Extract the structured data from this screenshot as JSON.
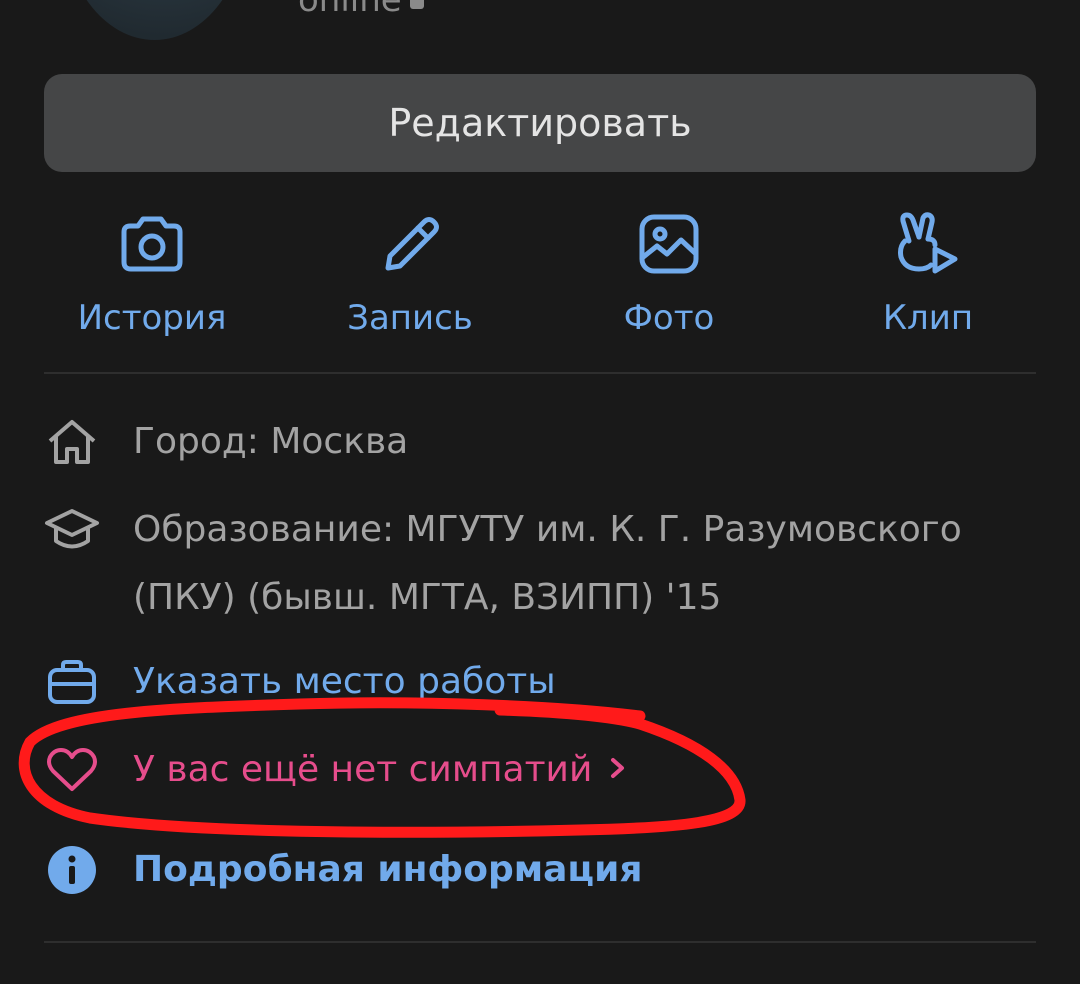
{
  "header": {
    "status": "online"
  },
  "edit_button": {
    "label": "Редактировать"
  },
  "actions": [
    {
      "label": "История",
      "icon": "camera-icon"
    },
    {
      "label": "Запись",
      "icon": "pencil-icon"
    },
    {
      "label": "Фото",
      "icon": "photo-icon"
    },
    {
      "label": "Клип",
      "icon": "clip-icon"
    }
  ],
  "info": {
    "city": {
      "text": "Город: Москва",
      "icon": "home-icon"
    },
    "education": {
      "line1": "Образование: МГУТУ им. К. Г. Разумовского",
      "line2": "(ПКУ) (бывш. МГТА, ВЗИПП) '15",
      "icon": "graduation-cap-icon"
    },
    "work": {
      "text": "Указать место работы",
      "icon": "briefcase-icon"
    },
    "likes": {
      "text": "У вас ещё нет симпатий",
      "icon": "heart-icon"
    },
    "details": {
      "text": "Подробная информация",
      "icon": "info-icon"
    }
  },
  "colors": {
    "background": "#191919",
    "accent_blue": "#71aaeb",
    "pink": "#e64d8c",
    "annotation_red": "#ff1a1a",
    "button_bg": "#454647"
  }
}
